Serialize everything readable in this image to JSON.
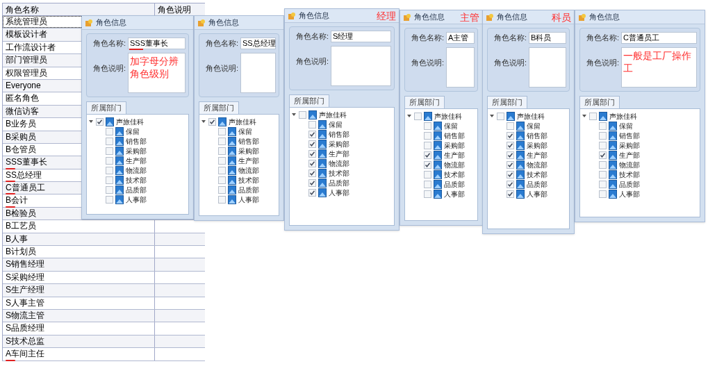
{
  "role_table": {
    "columns": [
      "角色名称",
      "角色说明"
    ],
    "rows": [
      {
        "name": "系统管理员",
        "selected": true,
        "underlined": false
      },
      {
        "name": "模板设计者",
        "selected": false,
        "underlined": false
      },
      {
        "name": "工作流设计者",
        "selected": false,
        "underlined": false
      },
      {
        "name": "部门管理员",
        "selected": false,
        "underlined": false
      },
      {
        "name": "权限管理员",
        "selected": false,
        "underlined": false
      },
      {
        "name": "Everyone",
        "selected": false,
        "underlined": false
      },
      {
        "name": "匿名角色",
        "selected": false,
        "underlined": false
      },
      {
        "name": "微信访客",
        "selected": false,
        "underlined": false
      },
      {
        "name": "B业务员",
        "selected": false,
        "underlined": false
      },
      {
        "name": "B采购员",
        "selected": false,
        "underlined": false
      },
      {
        "name": "B仓管员",
        "selected": false,
        "underlined": false
      },
      {
        "name": "SSS董事长",
        "selected": false,
        "underlined": true
      },
      {
        "name": "SS总经理",
        "selected": false,
        "underlined": true
      },
      {
        "name": "C普通员工",
        "selected": false,
        "underlined": true
      },
      {
        "name": "B会计",
        "selected": false,
        "underlined": true
      },
      {
        "name": "B检验员",
        "selected": false,
        "underlined": false
      },
      {
        "name": "B工艺员",
        "selected": false,
        "underlined": false
      },
      {
        "name": "B人事",
        "selected": false,
        "underlined": false
      },
      {
        "name": "B计划员",
        "selected": false,
        "underlined": false
      },
      {
        "name": "S销售经理",
        "selected": false,
        "underlined": false
      },
      {
        "name": "S采购经理",
        "selected": false,
        "underlined": false
      },
      {
        "name": "S生产经理",
        "selected": false,
        "underlined": false
      },
      {
        "name": "S人事主管",
        "selected": false,
        "underlined": false
      },
      {
        "name": "S物流主管",
        "selected": false,
        "underlined": false
      },
      {
        "name": "S品质经理",
        "selected": false,
        "underlined": false
      },
      {
        "name": "S技术总监",
        "selected": false,
        "underlined": false
      },
      {
        "name": "A车间主任",
        "selected": false,
        "underlined": true
      }
    ]
  },
  "dialogs": [
    {
      "title": "角色信息",
      "name_label": "角色名称:",
      "name_value": "SSS董事长",
      "name_value_underlined": true,
      "desc_label": "角色说明:",
      "description_note": "加字母分辨角色级别",
      "tab": "所属部门",
      "tree": {
        "label": "声旅佳科",
        "checked": true,
        "children": [
          {
            "label": "保留",
            "checked": false
          },
          {
            "label": "销售部",
            "checked": false
          },
          {
            "label": "采购部",
            "checked": false
          },
          {
            "label": "生产部",
            "checked": false
          },
          {
            "label": "物流部",
            "checked": false
          },
          {
            "label": "技术部",
            "checked": false
          },
          {
            "label": "品质部",
            "checked": false
          },
          {
            "label": "人事部",
            "checked": false
          }
        ]
      }
    },
    {
      "title": "角色信息",
      "name_label": "角色名称:",
      "name_value": "SS总经理",
      "desc_label": "角色说明:",
      "tab": "所属部门",
      "tree": {
        "label": "声旅佳科",
        "checked": true,
        "children": [
          {
            "label": "保留",
            "checked": false
          },
          {
            "label": "销售部",
            "checked": false
          },
          {
            "label": "采购部",
            "checked": false
          },
          {
            "label": "生产部",
            "checked": false
          },
          {
            "label": "物流部",
            "checked": false
          },
          {
            "label": "技术部",
            "checked": false
          },
          {
            "label": "品质部",
            "checked": false
          },
          {
            "label": "人事部",
            "checked": false
          }
        ]
      }
    },
    {
      "title": "角色信息",
      "name_label": "角色名称:",
      "name_value": "S经理",
      "desc_label": "角色说明:",
      "header_note": "经理",
      "tab": "所属部门",
      "tree": {
        "label": "声旅佳科",
        "checked": false,
        "children": [
          {
            "label": "保留",
            "checked": false
          },
          {
            "label": "销售部",
            "checked": true
          },
          {
            "label": "采购部",
            "checked": true
          },
          {
            "label": "生产部",
            "checked": true
          },
          {
            "label": "物流部",
            "checked": true
          },
          {
            "label": "技术部",
            "checked": true
          },
          {
            "label": "品质部",
            "checked": true
          },
          {
            "label": "人事部",
            "checked": true
          }
        ]
      }
    },
    {
      "title": "角色信息",
      "name_label": "角色名称:",
      "name_value": "A主管",
      "desc_label": "角色说明:",
      "header_note": "主管",
      "tab": "所属部门",
      "tree": {
        "label": "声旅佳科",
        "checked": false,
        "children": [
          {
            "label": "保留",
            "checked": false
          },
          {
            "label": "销售部",
            "checked": false
          },
          {
            "label": "采购部",
            "checked": false
          },
          {
            "label": "生产部",
            "checked": true
          },
          {
            "label": "物流部",
            "checked": true
          },
          {
            "label": "技术部",
            "checked": false
          },
          {
            "label": "品质部",
            "checked": false
          },
          {
            "label": "人事部",
            "checked": false
          }
        ]
      }
    },
    {
      "title": "角色信息",
      "name_label": "角色名称:",
      "name_value": "B科员",
      "desc_label": "角色说明:",
      "header_note": "科员",
      "tab": "所属部门",
      "tree": {
        "label": "声旅佳科",
        "checked": false,
        "children": [
          {
            "label": "保留",
            "checked": false
          },
          {
            "label": "销售部",
            "checked": true
          },
          {
            "label": "采购部",
            "checked": true
          },
          {
            "label": "生产部",
            "checked": true
          },
          {
            "label": "物流部",
            "checked": true
          },
          {
            "label": "技术部",
            "checked": true
          },
          {
            "label": "品质部",
            "checked": true
          },
          {
            "label": "人事部",
            "checked": true
          }
        ]
      }
    },
    {
      "title": "角色信息",
      "name_label": "角色名称:",
      "name_value": "C普通员工",
      "desc_label": "角色说明:",
      "description_note": "一般是工厂操作工",
      "tab": "所属部门",
      "tree": {
        "label": "声旅佳科",
        "checked": false,
        "children": [
          {
            "label": "保留",
            "checked": false
          },
          {
            "label": "销售部",
            "checked": false
          },
          {
            "label": "采购部",
            "checked": false
          },
          {
            "label": "生产部",
            "checked": true
          },
          {
            "label": "物流部",
            "checked": false
          },
          {
            "label": "技术部",
            "checked": false
          },
          {
            "label": "品质部",
            "checked": false
          },
          {
            "label": "人事部",
            "checked": false
          }
        ]
      }
    }
  ]
}
